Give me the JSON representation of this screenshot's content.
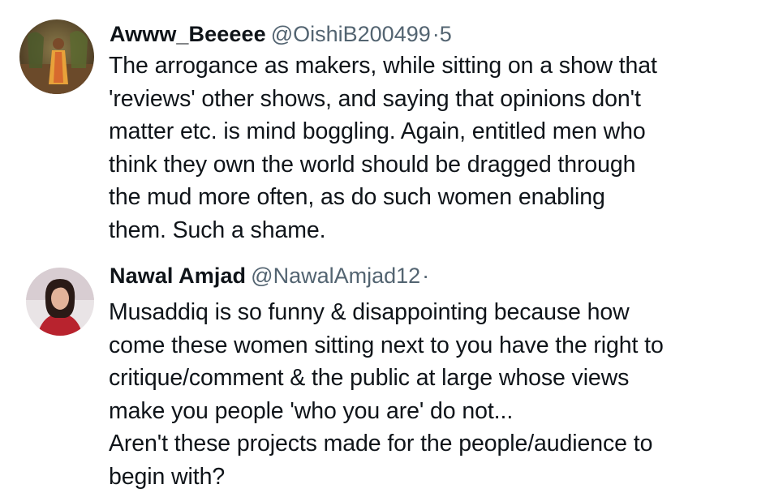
{
  "tweets": [
    {
      "display_name": "Awww_Beeeee",
      "handle": "@OishiB200499",
      "separator": "·",
      "truncated_time": "5",
      "body": "The arrogance as makers, while sitting on a show that\n'reviews' other shows, and saying that opinions don't\nmatter etc. is mind boggling. Again, entitled men who\nthink they own the world should be dragged through\nthe mud more often, as do such women enabling\nthem. Such a shame."
    },
    {
      "display_name": "Nawal Amjad",
      "handle": "@NawalAmjad12",
      "separator": "·",
      "truncated_time": "",
      "body": "Musaddiq is so funny & disappointing because how\ncome these women sitting next to you have the right to\ncritique/comment & the public at large whose views\nmake you people 'who you are' do not...\nAren't these projects made for the people/audience to\nbegin with?"
    }
  ]
}
